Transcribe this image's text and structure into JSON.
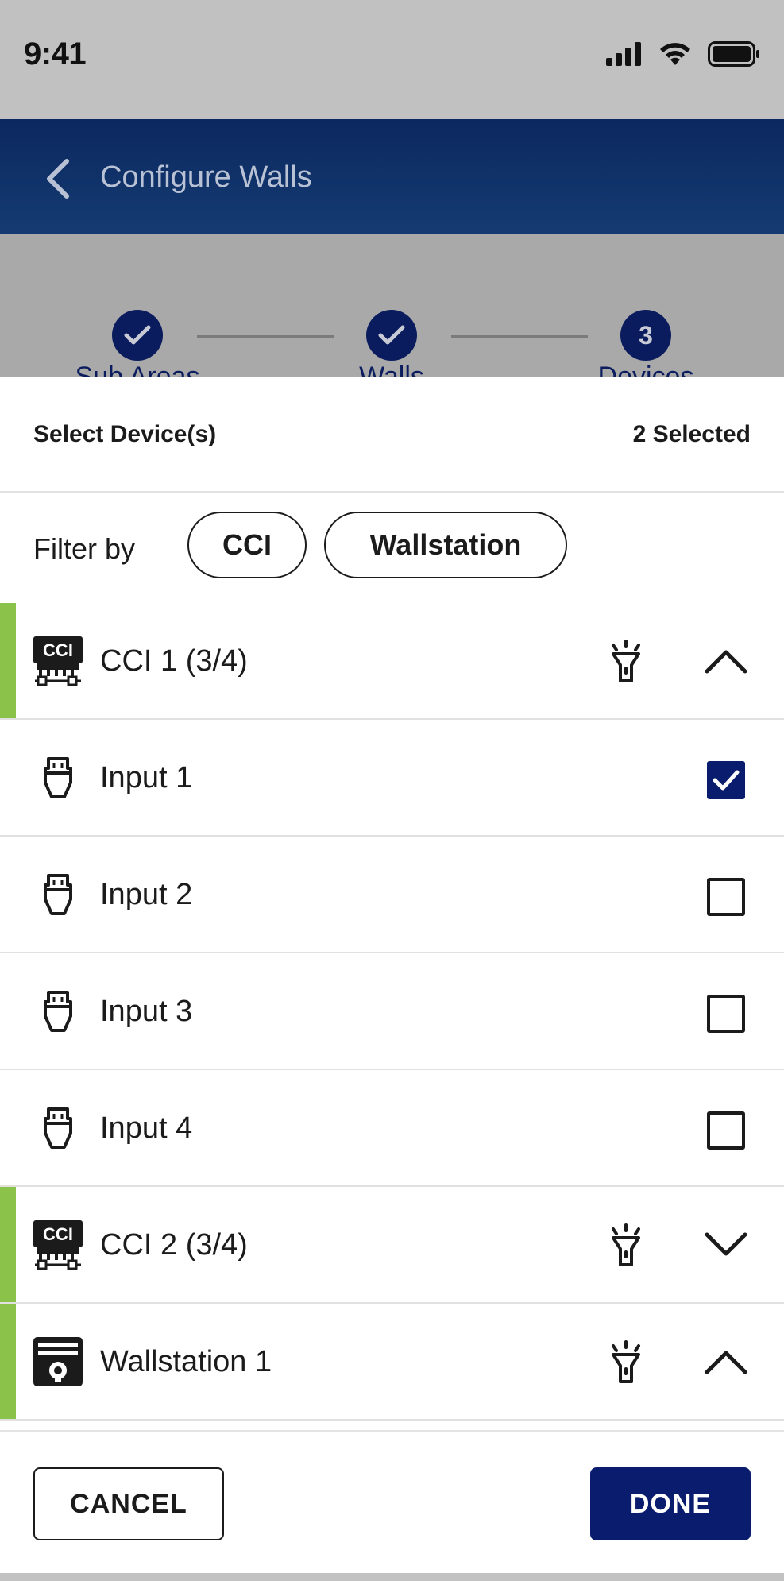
{
  "status_bar": {
    "time": "9:41",
    "icons": [
      "signal-icon",
      "wifi-icon",
      "battery-icon"
    ]
  },
  "header": {
    "title": "Configure Walls",
    "back_icon": "chevron-left-icon"
  },
  "stepper": {
    "steps": [
      {
        "label": "Sub Areas",
        "state": "complete"
      },
      {
        "label": "Walls",
        "state": "complete"
      },
      {
        "label": "Devices",
        "number": "3",
        "state": "current"
      }
    ]
  },
  "sheet": {
    "title": "Select Device(s)",
    "selected_count": "2 Selected",
    "filter": {
      "label": "Filter by",
      "chips": [
        "CCI",
        "Wallstation"
      ]
    },
    "rows": [
      {
        "type": "group",
        "icon": "cci-icon",
        "label": "CCI 1 (3/4)",
        "expanded": true
      },
      {
        "type": "item",
        "icon": "input-plug-icon",
        "label": "Input 1",
        "checked": true
      },
      {
        "type": "item",
        "icon": "input-plug-icon",
        "label": "Input 2",
        "checked": false
      },
      {
        "type": "item",
        "icon": "input-plug-icon",
        "label": "Input 3",
        "checked": false
      },
      {
        "type": "item",
        "icon": "input-plug-icon",
        "label": "Input 4",
        "checked": false
      },
      {
        "type": "group",
        "icon": "cci-icon",
        "label": "CCI 2 (3/4)",
        "expanded": false
      },
      {
        "type": "group",
        "icon": "wallstation-icon",
        "label": "Wallstation 1",
        "expanded": true
      }
    ]
  },
  "footer": {
    "cancel_label": "CANCEL",
    "done_label": "DONE"
  },
  "colors": {
    "primary": "#0a1c6e",
    "header_gradient_top": "#0c2860",
    "accent_green": "#8bc34a"
  }
}
